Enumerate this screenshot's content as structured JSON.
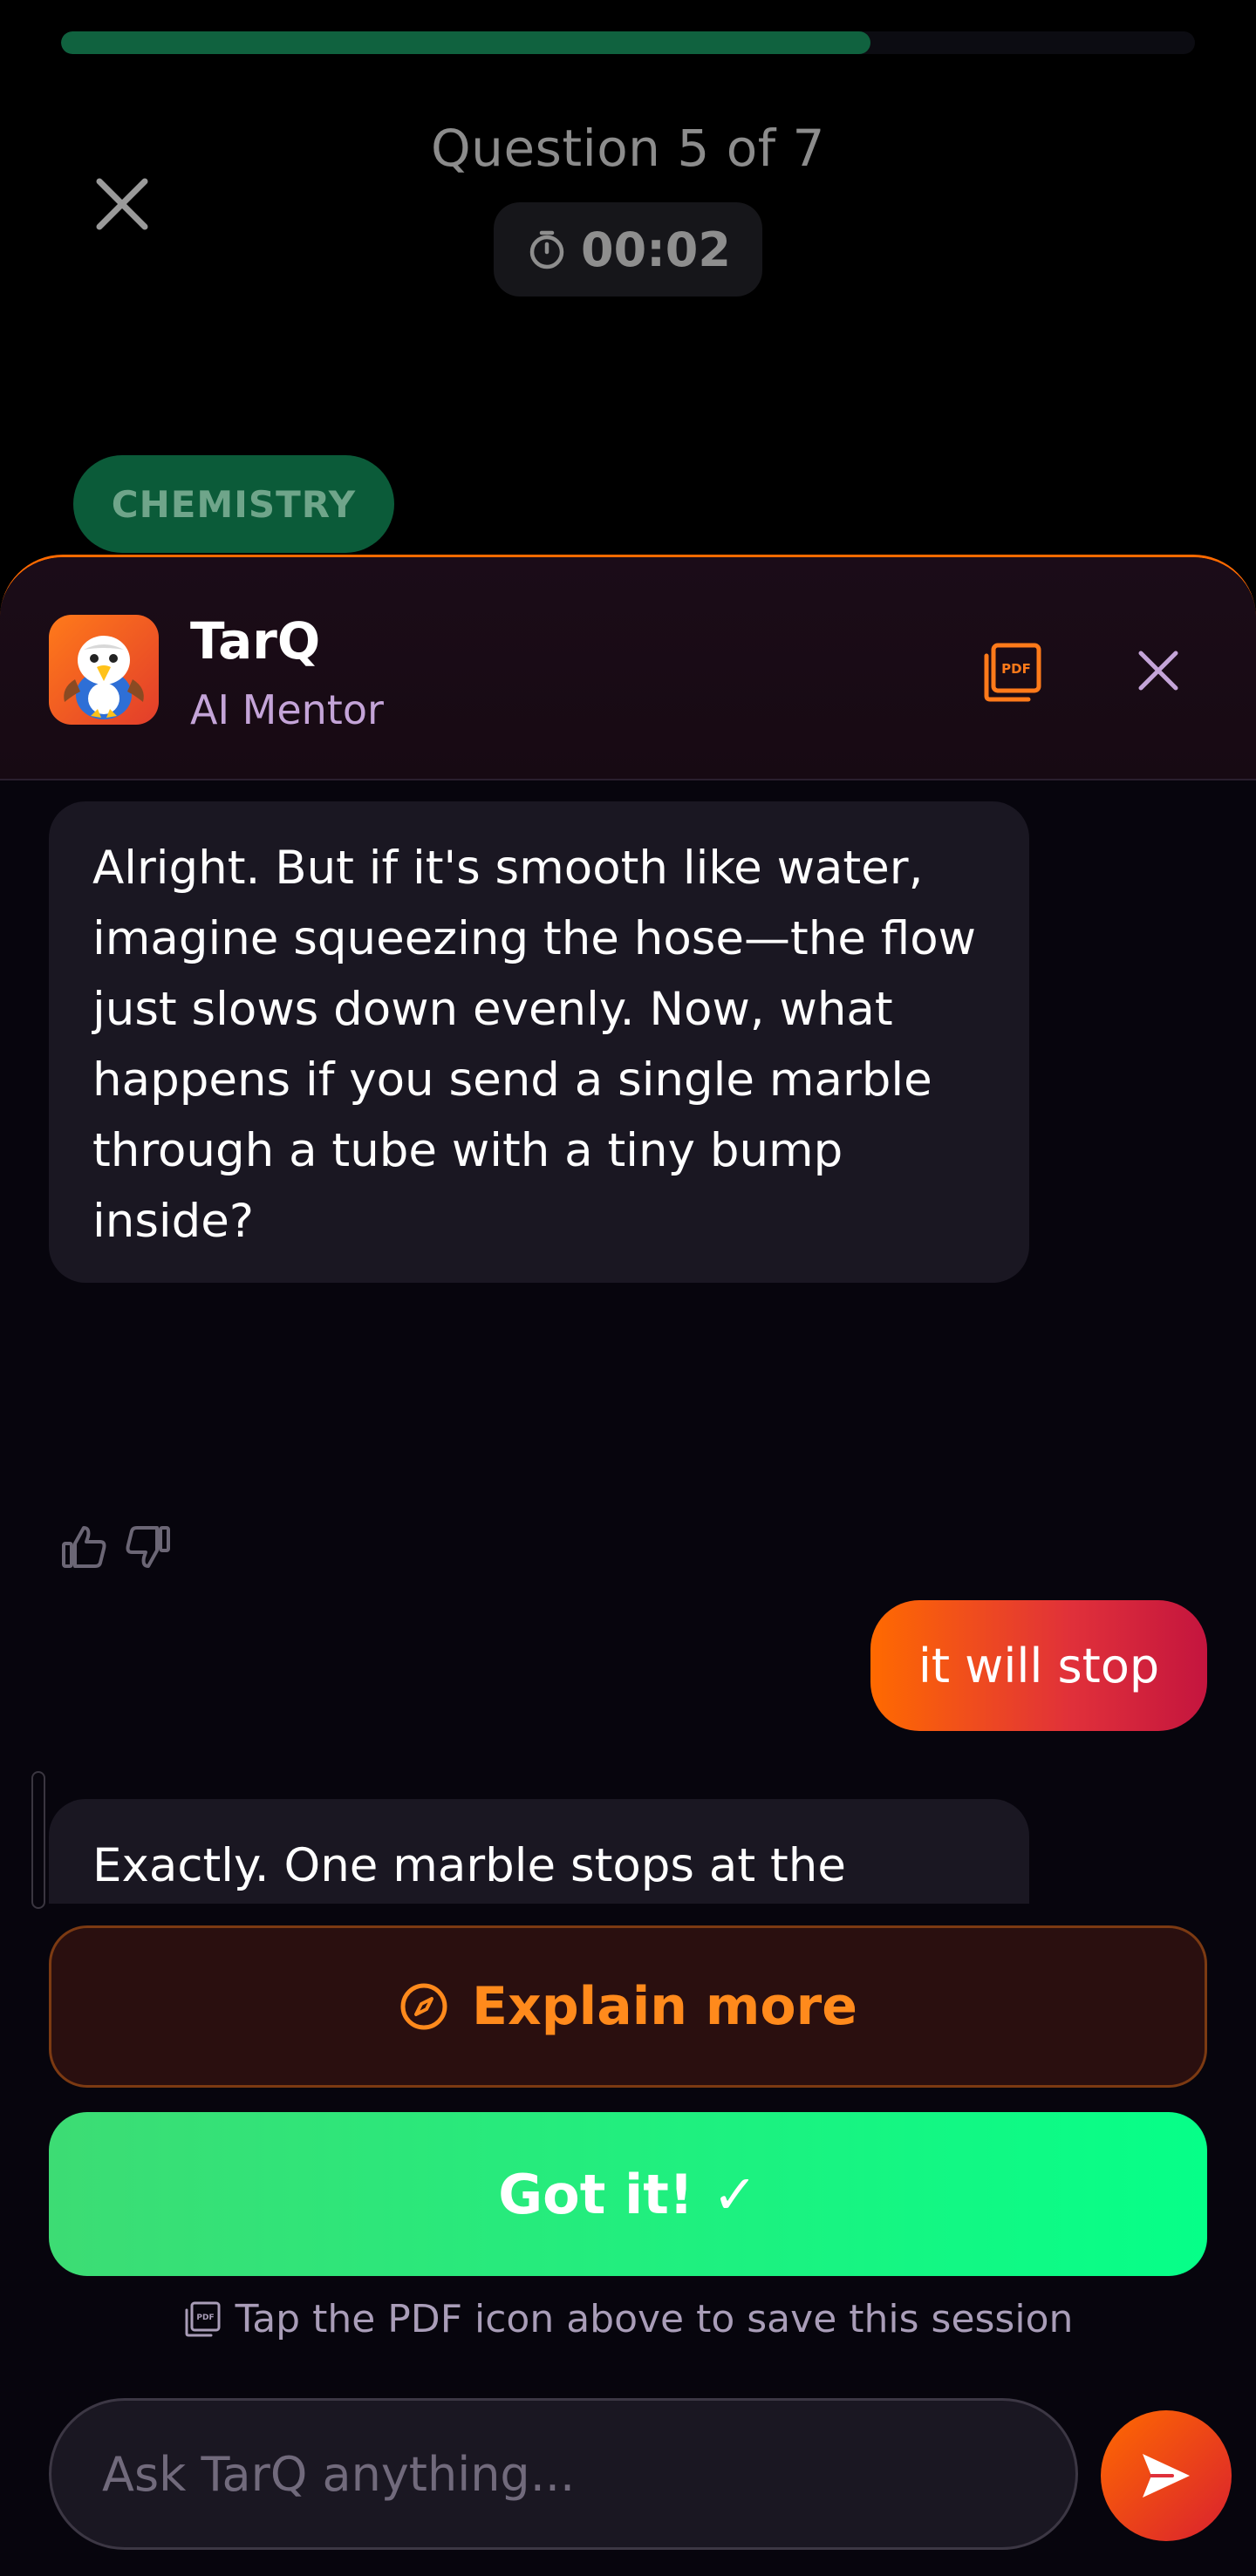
{
  "quiz": {
    "progress": 0.714,
    "question_label": "Question 5 of 7",
    "timer": "00:02",
    "subject": "CHEMISTRY"
  },
  "mentor": {
    "name": "TarQ",
    "role": "AI Mentor"
  },
  "messages": [
    {
      "from": "ai",
      "text": "Alright. But if it's smooth like water, imagine squeezing the hose—the flow just slows down evenly. Now, what happens if you send a single marble through a tube with a tiny bump inside?"
    },
    {
      "from": "user",
      "text": "it will stop"
    },
    {
      "from": "ai",
      "text": "Exactly. One marble stops at the bump. Now imagine a stream of marbles—one gets stuck, then another piles up behind it. Does that sound like smooth flow, or something"
    }
  ],
  "actions": {
    "explain_more": "Explain more",
    "got_it": "Got it! ✓"
  },
  "pdf_hint": "Tap the PDF icon above to save this session",
  "input": {
    "placeholder": "Ask TarQ anything..."
  },
  "colors": {
    "accent": "#ff6a00",
    "success": "#06ff88",
    "subject": "#0b5b39"
  },
  "icons": [
    "close-icon",
    "timer-icon",
    "pdf-icon",
    "thumbs-up-icon",
    "thumbs-down-icon",
    "compass-icon",
    "send-icon"
  ]
}
